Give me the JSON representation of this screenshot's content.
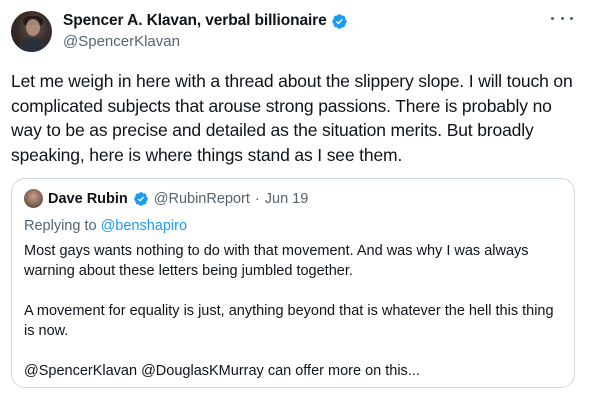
{
  "author": {
    "display_name": "Spencer A. Klavan, verbal billionaire",
    "handle": "@SpencerKlavan",
    "verified": true
  },
  "tweet": {
    "text": "Let me weigh in here with a thread about the slippery slope. I will touch on complicated subjects that arouse strong passions. There is probably no way to be as precise and detailed as the situation merits. But broadly speaking, here is where things stand as I see them."
  },
  "quoted_tweet": {
    "display_name": "Dave Rubin",
    "handle": "@RubinReport",
    "separator": "·",
    "date": "Jun 19",
    "verified": true,
    "replying_prefix": "Replying to",
    "replying_to": "@benshapiro",
    "paragraphs": [
      "Most gays wants nothing to do with that movement. And was why I was always warning about these letters being jumbled together.",
      "A movement for equality is just, anything beyond that is whatever the hell this thing is now.",
      "@SpencerKlavan @DouglasKMurray can offer more on this..."
    ]
  },
  "colors": {
    "verified_blue": "#1d9bf0",
    "secondary_text": "#536471",
    "border": "#cfd9de"
  },
  "icons": [
    "verified-badge-icon",
    "more-options-icon"
  ]
}
